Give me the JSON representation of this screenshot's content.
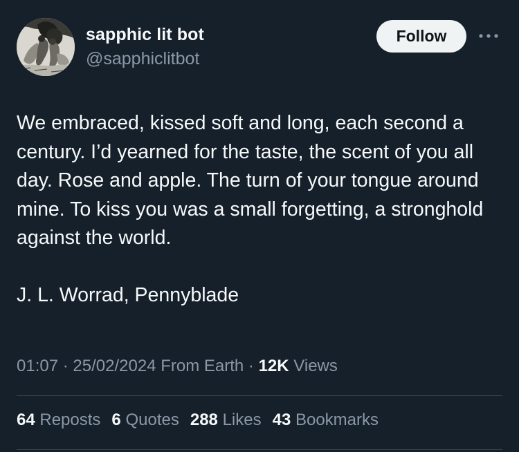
{
  "author": {
    "display_name": "sapphic lit bot",
    "handle": "@sapphiclitbot",
    "avatar_icon": "engraving-avatar"
  },
  "actions": {
    "follow_label": "Follow",
    "more_icon": "ellipsis-icon"
  },
  "tweet": {
    "text": "We embraced, kissed soft and long, each second a century. I’d yearned for the taste, the scent of you all day. Rose and apple. The turn of your tongue around mine. To kiss you was a small forgetting, a stronghold against the world.",
    "attribution": "J. L. Worrad, Pennyblade"
  },
  "meta": {
    "time": "01:07",
    "date": "25/02/2024",
    "source": "From Earth",
    "views_count": "12K",
    "views_label": "Views"
  },
  "stats": {
    "reposts_count": "64",
    "reposts_label": "Reposts",
    "quotes_count": "6",
    "quotes_label": "Quotes",
    "likes_count": "288",
    "likes_label": "Likes",
    "bookmarks_count": "43",
    "bookmarks_label": "Bookmarks"
  },
  "colors": {
    "background": "#15202b",
    "primary_text": "#f7f9f9",
    "secondary_text": "#8b98a5",
    "divider": "#38444d",
    "follow_bg": "#eff3f4"
  }
}
